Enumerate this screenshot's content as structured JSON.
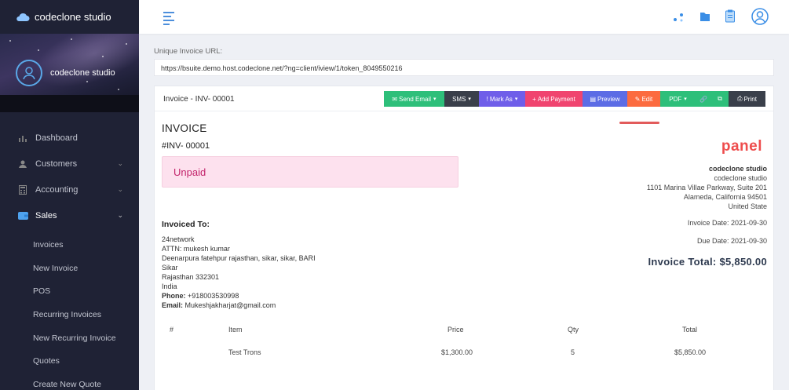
{
  "app": {
    "brand": "codeclone studio",
    "user_name": "codeclone studio"
  },
  "sidebar": {
    "items": [
      {
        "label": "Dashboard",
        "icon": "bar-chart-icon"
      },
      {
        "label": "Customers",
        "icon": "user-icon"
      },
      {
        "label": "Accounting",
        "icon": "calculator-icon"
      },
      {
        "label": "Sales",
        "icon": "wallet-icon"
      }
    ],
    "sales_sub": [
      "Invoices",
      "New Invoice",
      "POS",
      "Recurring Invoices",
      "New Recurring Invoice",
      "Quotes",
      "Create New Quote"
    ]
  },
  "url": {
    "label": "Unique Invoice URL:",
    "value": "https://bsuite.demo.host.codeclone.net/?ng=client/iview/1/token_8049550216"
  },
  "card": {
    "title": "Invoice - INV- 00001"
  },
  "buttons": [
    {
      "label": "Send Email",
      "prefix": "✉",
      "caret": true,
      "color": "#2ebf7a"
    },
    {
      "label": "SMS",
      "prefix": "",
      "caret": true,
      "color": "#3a3f4a"
    },
    {
      "label": "Mark As",
      "prefix": "!",
      "caret": true,
      "color": "#6f5ee9"
    },
    {
      "label": "Add Payment",
      "prefix": "+",
      "caret": false,
      "color": "#f0446f"
    },
    {
      "label": "Preview",
      "prefix": "▤",
      "caret": false,
      "color": "#5c6ce5"
    },
    {
      "label": "Edit",
      "prefix": "✎",
      "caret": false,
      "color": "#fc6b3f"
    },
    {
      "label": "PDF",
      "prefix": "",
      "caret": true,
      "color": "#2ebf7a"
    },
    {
      "label": "",
      "prefix": "🔗",
      "caret": false,
      "color": "#2ebf7a"
    },
    {
      "label": "",
      "prefix": "⧉",
      "caret": false,
      "color": "#2ebf7a"
    },
    {
      "label": "Print",
      "prefix": "⎙",
      "caret": false,
      "color": "#3a3f4a"
    }
  ],
  "invoice": {
    "heading": "INVOICE",
    "number": "#INV- 00001",
    "status": "Unpaid",
    "logo_text": "panel",
    "company": [
      "codeclone studio",
      "codeclone studio",
      "1101 Marina Villae Parkway, Suite 201",
      "Alameda, California 94501",
      "United State"
    ],
    "invoice_date": "Invoice Date: 2021-09-30",
    "due_date": "Due Date: 2021-09-30",
    "total": "Invoice Total: $5,850.00",
    "invoiced_to_label": "Invoiced To:",
    "address": [
      "24network",
      "ATTN: mukesh kumar",
      "Deenarpura fatehpur rajasthan, sikar, sikar, BARI",
      "Sikar",
      "Rajasthan 332301",
      "India"
    ],
    "phone_label": "Phone:",
    "phone": " +918003530998",
    "email_label": "Email:",
    "email": " Mukeshjakharjat@gmail.com"
  },
  "table": {
    "headers": [
      "#",
      "Item",
      "Price",
      "Qty",
      "Total"
    ],
    "rows": [
      {
        "num": "",
        "item": "Test Trons",
        "price": "$1,300.00",
        "qty": "5",
        "total": "$5,850.00"
      }
    ]
  }
}
